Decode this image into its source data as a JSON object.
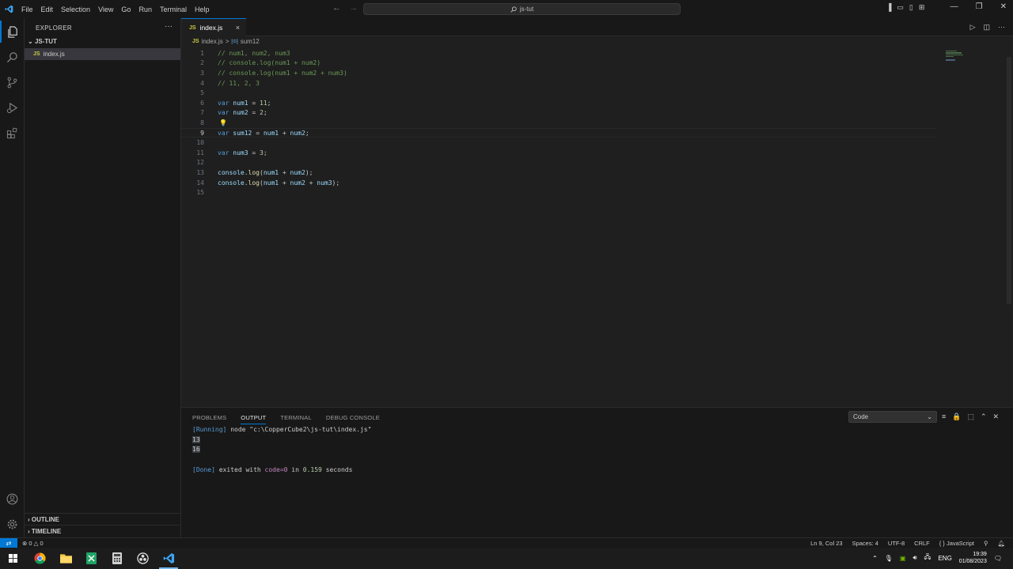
{
  "titlebar": {
    "menu": [
      "File",
      "Edit",
      "Selection",
      "View",
      "Go",
      "Run",
      "Terminal",
      "Help"
    ],
    "search_text": "js-tut"
  },
  "sidebar": {
    "title": "EXPLORER",
    "folder": "JS-TUT",
    "file": "index.js",
    "file_badge": "JS",
    "outline": "OUTLINE",
    "timeline": "TIMELINE"
  },
  "tabs": [
    {
      "badge": "JS",
      "label": "index.js",
      "close": "×"
    }
  ],
  "breadcrumb": {
    "file": "index.js",
    "separator": ">",
    "symbol_icon": "[⊙]",
    "symbol": "sum12"
  },
  "editor": {
    "current_line": 9,
    "lines": [
      {
        "n": "1",
        "text": "// num1, num2, num3"
      },
      {
        "n": "2",
        "text": "// console.log(num1 + num2)"
      },
      {
        "n": "3",
        "text": "// console.log(num1 + num2 + num3)"
      },
      {
        "n": "4",
        "text": "// 11, 2, 3"
      },
      {
        "n": "5",
        "text": ""
      },
      {
        "n": "6",
        "text": "var num1 = 11;"
      },
      {
        "n": "7",
        "text": "var num2 = 2;"
      },
      {
        "n": "8",
        "text": ""
      },
      {
        "n": "9",
        "text": "var sum12 = num1 + num2;"
      },
      {
        "n": "10",
        "text": ""
      },
      {
        "n": "11",
        "text": "var num3 = 3;"
      },
      {
        "n": "12",
        "text": ""
      },
      {
        "n": "13",
        "text": "console.log(num1 + num2);"
      },
      {
        "n": "14",
        "text": "console.log(num1 + num2 + num3);"
      },
      {
        "n": "15",
        "text": ""
      }
    ]
  },
  "panel": {
    "tabs": [
      "PROBLEMS",
      "OUTPUT",
      "TERMINAL",
      "DEBUG CONSOLE"
    ],
    "active_tab": "OUTPUT",
    "channel": "Code",
    "output": {
      "running_tag": "[Running]",
      "command": "node \"c:\\CopperCube2\\js-tut\\index.js\"",
      "result1": "13",
      "result2": "16",
      "done_tag": "[Done]",
      "exit_text": "exited with",
      "exit_code": "code=0",
      "in_text": "in",
      "duration": "0.159",
      "seconds": "seconds"
    }
  },
  "statusbar": {
    "problems": "⊗ 0 △ 0",
    "cursor": "Ln 9, Col 23",
    "spaces": "Spaces: 4",
    "encoding": "UTF-8",
    "eol": "CRLF",
    "language": "{ } JavaScript"
  },
  "taskbar": {
    "language": "ENG",
    "time": "19:39",
    "date": "01/08/2023"
  },
  "colors": {
    "accent": "#0078d4",
    "comment": "#6a9955",
    "keyword": "#569cd6",
    "variable": "#9cdcfe",
    "number": "#b5cea8"
  }
}
